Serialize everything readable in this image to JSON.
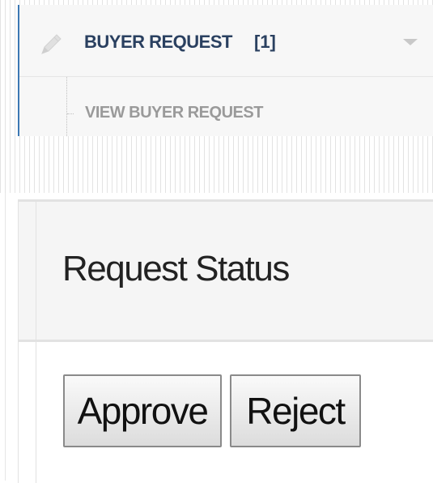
{
  "sidebar": {
    "menu": {
      "label": "BUYER REQUEST",
      "count": "[1]",
      "icon": "pencil-icon",
      "expand_icon": "caret-down-icon",
      "accent_color": "#3c78b4",
      "submenu": [
        {
          "label": "VIEW BUYER REQUEST"
        }
      ]
    }
  },
  "panel": {
    "title": "Request Status",
    "buttons": {
      "approve": "Approve",
      "reject": "Reject"
    }
  }
}
